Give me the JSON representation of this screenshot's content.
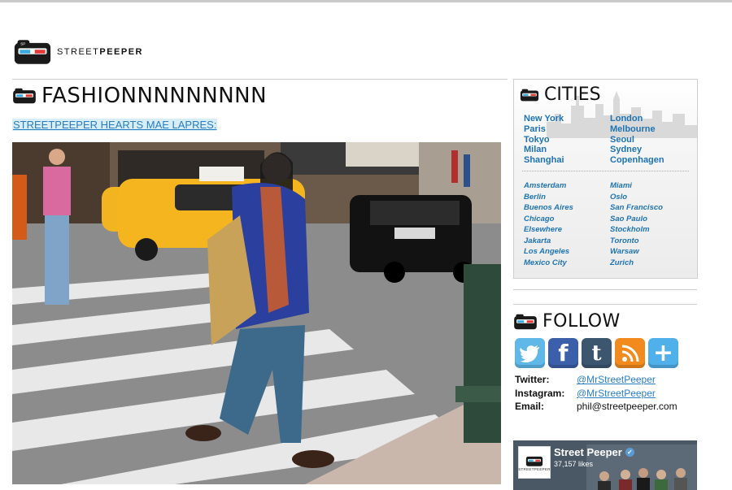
{
  "logo": {
    "brand_prefix": "STREET",
    "brand_suffix": "PEEPER"
  },
  "main": {
    "section_title": "FASHIONNNNNNNNN",
    "post_link": "STREETPEEPER HEARTS MAE LAPRES:"
  },
  "cities": {
    "title": "CITIES",
    "major": [
      "New York",
      "London",
      "Paris",
      "Melbourne",
      "Tokyo",
      "Seoul",
      "Milan",
      "Sydney",
      "Shanghai",
      "Copenhagen"
    ],
    "minor": [
      "Amsterdam",
      "Miami",
      "Berlin",
      "Oslo",
      "Buenos Aires",
      "San Francisco",
      "Chicago",
      "Sao Paulo",
      "Elsewhere",
      "Stockholm",
      "Jakarta",
      "Toronto",
      "Los Angeles",
      "Warsaw",
      "Mexico City",
      "Zurich"
    ]
  },
  "follow": {
    "title": "FOLLOW",
    "icons": [
      "twitter-icon",
      "facebook-icon",
      "tumblr-icon",
      "rss-icon",
      "plus-icon"
    ],
    "twitter_label": "Twitter:",
    "twitter_value": "@MrStreetPeeper",
    "instagram_label": "Instagram:",
    "instagram_value": "@MrStreetPeeper",
    "email_label": "Email:",
    "email_value": "phil@streetpeeper.com"
  },
  "facebook": {
    "page_name": "Street Peeper",
    "likes": "37,157 likes",
    "thumb_text": "STREETPEEPER"
  }
}
